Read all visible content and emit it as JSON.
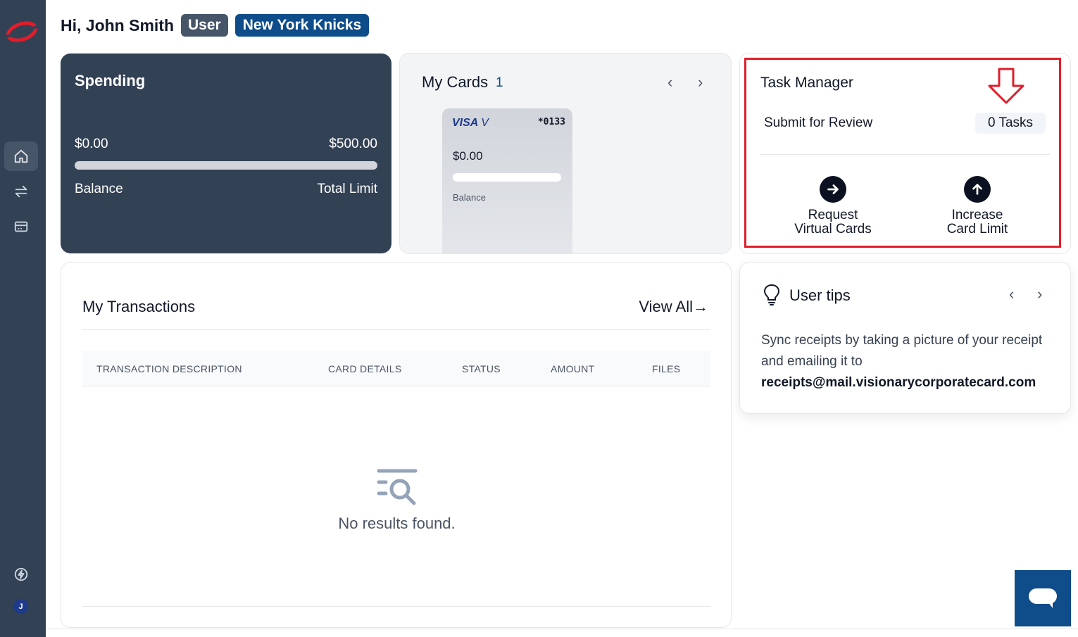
{
  "header": {
    "greeting": "Hi, John Smith",
    "role_badge": "User",
    "team_badge": "New York Knicks"
  },
  "sidebar": {
    "items": [
      {
        "icon": "home-icon",
        "active": true
      },
      {
        "icon": "transfer-icon",
        "active": false
      },
      {
        "icon": "card-icon",
        "active": false
      }
    ],
    "bottom": {
      "bolt_icon": "bolt-icon",
      "avatar_initial": "J"
    }
  },
  "spending": {
    "title": "Spending",
    "balance_amount": "$0.00",
    "limit_amount": "$500.00",
    "balance_label": "Balance",
    "limit_label": "Total Limit"
  },
  "my_cards": {
    "title": "My Cards",
    "count": "1",
    "card": {
      "brand": "VISA",
      "brand_suffix": "V",
      "last4": "*0133",
      "balance": "$0.00",
      "balance_label": "Balance"
    }
  },
  "task_manager": {
    "title": "Task Manager",
    "submit_label": "Submit for Review",
    "tasks_count": "0 Tasks",
    "action_request_line1": "Request",
    "action_request_line2": "Virtual Cards",
    "action_increase_line1": "Increase",
    "action_increase_line2": "Card Limit"
  },
  "transactions": {
    "title": "My Transactions",
    "view_all": "View All",
    "columns": [
      "TRANSACTION DESCRIPTION",
      "CARD DETAILS",
      "STATUS",
      "AMOUNT",
      "FILES"
    ],
    "empty_text": "No results found."
  },
  "tips": {
    "title": "User tips",
    "text": "Sync receipts by taking a picture of your receipt and emailing it to",
    "email": "receipts@mail.visionarycorporatecard.com"
  },
  "colors": {
    "sidebar": "#334155",
    "brand_blue": "#0f4c8a",
    "highlight_red": "#e11d2a"
  }
}
